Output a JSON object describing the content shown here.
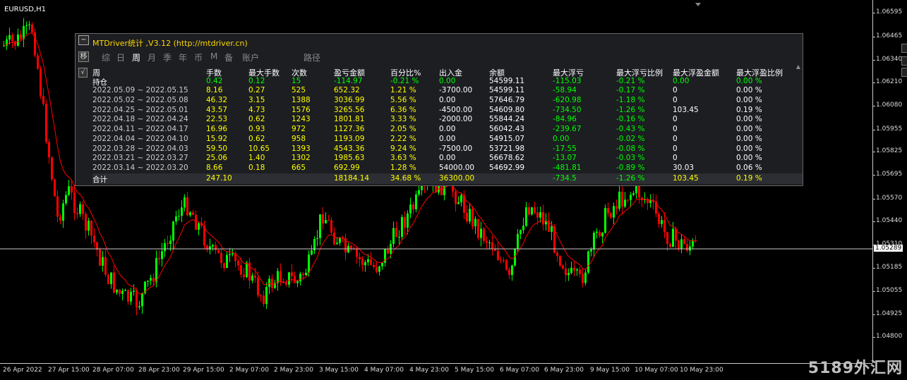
{
  "window": {
    "symbol": "EURUSD,H1"
  },
  "price_axis": {
    "ticks": [
      "1.06595",
      "1.06465",
      "1.06340",
      "1.06210",
      "1.06080",
      "1.05955",
      "1.05825",
      "1.05695",
      "1.05570",
      "1.05440",
      "1.05310",
      "1.05185",
      "1.05055",
      "1.04925",
      "1.04800"
    ],
    "current_price": "1.05289"
  },
  "time_axis": {
    "ticks": [
      "26 Apr 2022",
      "27 Apr 15:00",
      "28 Apr 07:00",
      "28 Apr 23:00",
      "29 Apr 15:00",
      "2 May 07:00",
      "2 May 23:00",
      "3 May 15:00",
      "4 May 07:00",
      "4 May 23:00",
      "5 May 15:00",
      "6 May 07:00",
      "6 May 23:00",
      "9 May 15:00",
      "10 May 07:00",
      "10 May 23:00"
    ]
  },
  "watermark": "5189外汇网",
  "colors": {
    "bull": "#00ff00",
    "bear": "#ff0000",
    "ma": "#ff0000",
    "value_yellow": "#ffff00",
    "value_green": "#00ff00",
    "value_white": "#ffffff",
    "title": "#ffd700"
  },
  "panel": {
    "title": "MTDriver统计 ,V3.12 (http://mtdriver.cn)",
    "collapse_icon": "−",
    "move_icon": "移",
    "check_icon": "√",
    "tabs": [
      "综",
      "日",
      "周",
      "月",
      "季",
      "年",
      "币",
      "M",
      "备",
      "账户",
      "路径"
    ],
    "active_tab": "周",
    "columns": [
      "周",
      "手数",
      "最大手数",
      "次数",
      "盈亏金额",
      "百分比%",
      "出入金",
      "余额",
      "最大浮亏",
      "最大浮亏比例",
      "最大浮盈金额",
      "最大浮盈比例"
    ],
    "open_row": [
      "持仓",
      "0.42",
      "0.12",
      "15",
      "-114.97",
      "-0.21 %",
      "0.00",
      "54599.11",
      "-115.03",
      "-0.21 %",
      "0.00",
      "0.00 %"
    ],
    "rows": [
      [
        "2022.05.09 ~ 2022.05.15",
        "8.16",
        "0.27",
        "525",
        "652.32",
        "1.21 %",
        "-3700.00",
        "54599.11",
        "-58.94",
        "-0.17 %",
        "0",
        "0.00 %"
      ],
      [
        "2022.05.02 ~ 2022.05.08",
        "46.32",
        "3.15",
        "1388",
        "3036.99",
        "5.56 %",
        "0.00",
        "57646.79",
        "-620.98",
        "-1.18 %",
        "0",
        "0.00 %"
      ],
      [
        "2022.04.25 ~ 2022.05.01",
        "43.57",
        "4.73",
        "1576",
        "3265.56",
        "6.36 %",
        "-4500.00",
        "54609.80",
        "-734.50",
        "-1.26 %",
        "103.45",
        "0.19 %"
      ],
      [
        "2022.04.18 ~ 2022.04.24",
        "22.53",
        "0.62",
        "1243",
        "1801.81",
        "3.33 %",
        "-2000.00",
        "55844.24",
        "-84.96",
        "-0.16 %",
        "0",
        "0.00 %"
      ],
      [
        "2022.04.11 ~ 2022.04.17",
        "16.96",
        "0.93",
        "972",
        "1127.36",
        "2.05 %",
        "0.00",
        "56042.43",
        "-239.67",
        "-0.43 %",
        "0",
        "0.00 %"
      ],
      [
        "2022.04.04 ~ 2022.04.10",
        "15.92",
        "0.62",
        "958",
        "1193.09",
        "2.22 %",
        "0.00",
        "54915.07",
        "0.00",
        "-0.02 %",
        "0",
        "0.00 %"
      ],
      [
        "2022.03.28 ~ 2022.04.03",
        "59.50",
        "10.65",
        "1393",
        "4543.36",
        "9.24 %",
        "-7500.00",
        "53721.98",
        "-17.55",
        "-0.08 %",
        "0",
        "0.00 %"
      ],
      [
        "2022.03.21 ~ 2022.03.27",
        "25.06",
        "1.40",
        "1302",
        "1985.63",
        "3.63 %",
        "0.00",
        "56678.62",
        "-13.07",
        "-0.03 %",
        "0",
        "0.00 %"
      ],
      [
        "2022.03.14 ~ 2022.03.20",
        "8.66",
        "0.18",
        "665",
        "692.99",
        "1.28 %",
        "54000.00",
        "54692.99",
        "-481.81",
        "-0.89 %",
        "30.03",
        "0.06 %"
      ]
    ],
    "total_row": [
      "合计",
      "247.10",
      "",
      "",
      "18184.14",
      "34.68 %",
      "36300.00",
      "",
      "-734.5",
      "-1.26 %",
      "103.45",
      "0.19 %"
    ],
    "scroll_icon": "▲"
  }
}
